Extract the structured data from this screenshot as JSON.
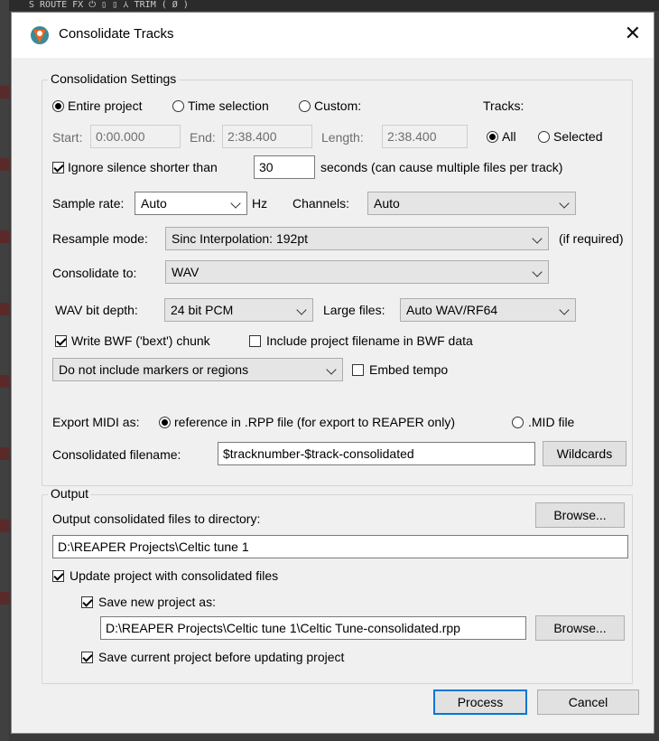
{
  "dialog": {
    "title": "Consolidate Tracks",
    "close_symbol": "✕"
  },
  "background": {
    "strip_text": "S  ROUTE  FX  ⏻ ▯   ▯ ⅄ TRIM ( Ø )"
  },
  "settings": {
    "group_label": "Consolidation Settings",
    "scope_options": [
      "Entire project",
      "Time selection",
      "Custom:"
    ],
    "tracks_label": "Tracks:",
    "tracks_options": [
      "All",
      "Selected"
    ],
    "start_label": "Start:",
    "start_value": "0:00.000",
    "end_label": "End:",
    "end_value": "2:38.400",
    "length_label": "Length:",
    "length_value": "2:38.400",
    "ignore_silence_label": "Ignore silence shorter than",
    "ignore_silence_value": "30",
    "ignore_silence_suffix": "seconds (can cause multiple files per track)",
    "sample_rate_label": "Sample rate:",
    "sample_rate_value": "Auto",
    "hz_label": "Hz",
    "channels_label": "Channels:",
    "channels_value": "Auto",
    "resample_label": "Resample mode:",
    "resample_value": "Sinc Interpolation: 192pt",
    "resample_note": "(if required)",
    "consolidate_to_label": "Consolidate to:",
    "consolidate_to_value": "WAV",
    "wav_bit_depth_label": "WAV bit depth:",
    "wav_bit_depth_value": "24 bit PCM",
    "large_files_label": "Large files:",
    "large_files_value": "Auto WAV/RF64",
    "write_bwf_label": "Write BWF ('bext') chunk",
    "include_filename_label": "Include project filename in BWF data",
    "markers_value": "Do not include markers or regions",
    "embed_tempo_label": "Embed tempo",
    "export_midi_label": "Export MIDI as:",
    "export_midi_options": [
      "reference in .RPP file (for export to REAPER only)",
      ".MID file"
    ],
    "filename_label": "Consolidated filename:",
    "filename_value": "$tracknumber-$track-consolidated",
    "wildcards_button": "Wildcards"
  },
  "output": {
    "group_label": "Output",
    "dir_label": "Output consolidated files to directory:",
    "browse_button": "Browse...",
    "dir_value": "D:\\REAPER Projects\\Celtic tune 1",
    "update_label": "Update project with consolidated files",
    "save_new_label": "Save new project as:",
    "save_new_value": "D:\\REAPER Projects\\Celtic tune 1\\Celtic Tune-consolidated.rpp",
    "browse2_button": "Browse...",
    "save_current_label": "Save current project before updating project"
  },
  "buttons": {
    "process": "Process",
    "cancel": "Cancel"
  }
}
